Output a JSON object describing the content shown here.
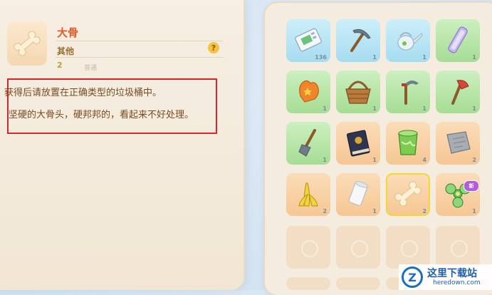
{
  "detail": {
    "title": "大骨",
    "category": "其他",
    "help": "?",
    "quantity": "2",
    "rarity": "普通",
    "description_line1": "获得后请放置在正确类型的垃圾桶中。",
    "description_line2": "坚硬的大骨头，硬邦邦的，看起来不好处理。"
  },
  "inventory": {
    "slots": [
      {
        "name": "ticket-slot",
        "icon": "ticket-icon",
        "count": "136",
        "bg": "blue"
      },
      {
        "name": "pickaxe-slot",
        "icon": "pickaxe-icon",
        "count": "1",
        "bg": "blue"
      },
      {
        "name": "watering-can-slot",
        "icon": "watering-can-icon",
        "count": "1",
        "bg": "blue"
      },
      {
        "name": "purple-bar-slot",
        "icon": "purple-bar-icon",
        "count": "1",
        "bg": "green"
      },
      {
        "name": "glove-slot",
        "icon": "glove-icon",
        "count": "1",
        "bg": "green"
      },
      {
        "name": "basket-slot",
        "icon": "basket-icon",
        "count": "1",
        "bg": "green"
      },
      {
        "name": "sickle-slot",
        "icon": "sickle-icon",
        "count": "1",
        "bg": "green"
      },
      {
        "name": "axe-slot",
        "icon": "axe-icon",
        "count": "1",
        "bg": "green"
      },
      {
        "name": "shovel-slot",
        "icon": "shovel-icon",
        "count": "1",
        "bg": "green"
      },
      {
        "name": "book-slot",
        "icon": "book-icon",
        "count": "1",
        "bg": "orange"
      },
      {
        "name": "paint-bucket-slot",
        "icon": "paint-bucket-icon",
        "count": "4",
        "bg": "orange"
      },
      {
        "name": "stone-tablet-slot",
        "icon": "stone-tablet-icon",
        "count": "2",
        "bg": "orange"
      },
      {
        "name": "banana-peel-slot",
        "icon": "banana-peel-icon",
        "count": "2",
        "bg": "orange"
      },
      {
        "name": "paper-roll-slot",
        "icon": "paper-roll-icon",
        "count": "1",
        "bg": "orange"
      },
      {
        "name": "bone-slot",
        "icon": "bone-icon",
        "count": "2",
        "bg": "orange"
      },
      {
        "name": "fidget-spinner-slot",
        "icon": "fidget-spinner-icon",
        "count": "1",
        "bg": "orange"
      }
    ],
    "new_badge": "新"
  },
  "watermark": {
    "title": "这里下载站",
    "url": "heredown.com",
    "logo": "Z"
  },
  "colors": {
    "title": "#e05a2d",
    "highlight_box": "#d8242a",
    "selected_slot": "#f4d634"
  }
}
